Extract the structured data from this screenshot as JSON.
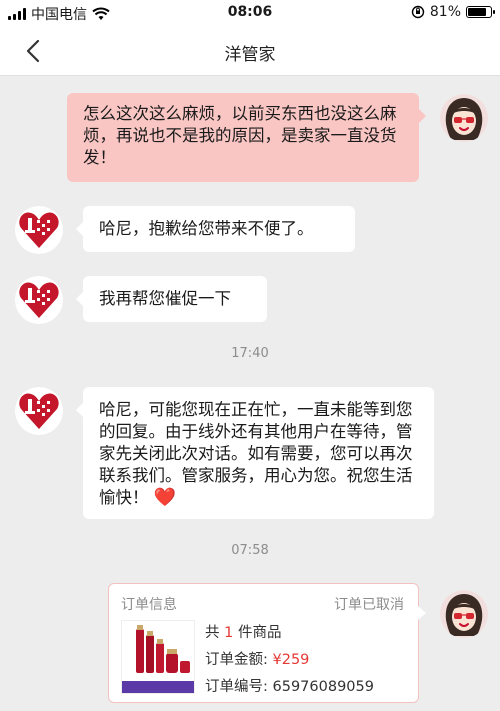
{
  "status_bar": {
    "carrier": "中国电信",
    "time": "08:06",
    "battery_percent": "81%",
    "battery_level": 0.81,
    "wifi_icon": "wifi-icon",
    "rotation_lock_icon": "rotation-lock-icon"
  },
  "nav": {
    "title": "洋管家",
    "back_icon": "chevron-left-icon"
  },
  "messages": [
    {
      "from": "self",
      "text": "怎么这次这么麻烦，以前买东西也没这么麻烦，再说也不是我的原因，是卖家一直没货发！"
    },
    {
      "from": "agent",
      "text": "哈尼，抱歉给您带来不便了。",
      "avatar_text": "洋码头"
    },
    {
      "from": "agent",
      "text": "我再帮您催促一下",
      "avatar_text": "洋码头"
    },
    {
      "timestamp": "17:40"
    },
    {
      "from": "agent",
      "text": "哈尼，可能您现在正在忙，一直未能等到您的回复。由于线外还有其他用户在等待，管家先关闭此次对话。如有需要，您可以再次联系我们。管家服务，用心为您。祝您生活愉快！",
      "emoji": "❤️",
      "avatar_text": "洋码头"
    },
    {
      "timestamp": "07:58"
    }
  ],
  "order_card": {
    "header": "订单信息",
    "status": "订单已取消",
    "count_prefix": "共",
    "count": "1",
    "count_suffix": "件商品",
    "amount_label": "订单金额:",
    "amount": "¥259",
    "order_no_label": "订单编号:",
    "order_no": "65976089059"
  },
  "colors": {
    "self_bubble": "#f9c6c4",
    "brand_red": "#c4172b",
    "price_red": "#e53935",
    "background": "#ededed"
  }
}
